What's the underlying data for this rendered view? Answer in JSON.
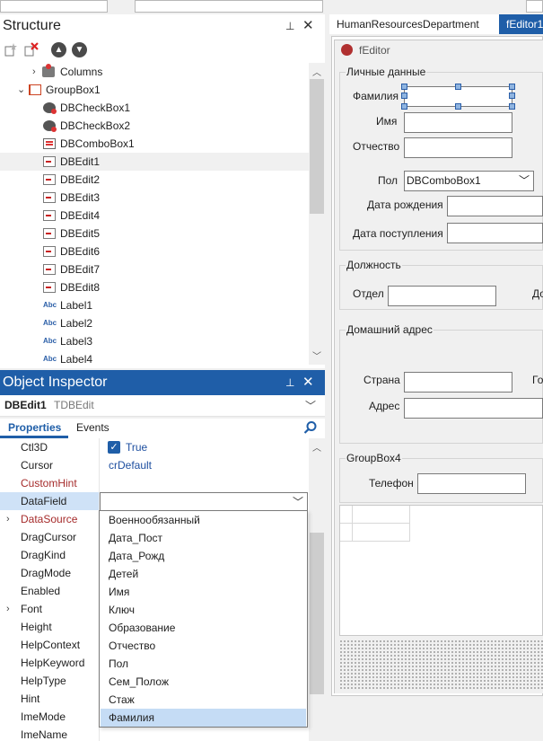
{
  "structure": {
    "title": "Structure",
    "tree": [
      {
        "label": "Columns",
        "icon": "columns-icon",
        "expanded": false
      },
      {
        "label": "GroupBox1",
        "icon": "groupbox-icon",
        "expanded": true
      },
      {
        "label": "DBCheckBox1",
        "icon": "checkbox-icon"
      },
      {
        "label": "DBCheckBox2",
        "icon": "checkbox-icon"
      },
      {
        "label": "DBComboBox1",
        "icon": "combobox-icon"
      },
      {
        "label": "DBEdit1",
        "icon": "edit-icon",
        "selected": true
      },
      {
        "label": "DBEdit2",
        "icon": "edit-icon"
      },
      {
        "label": "DBEdit3",
        "icon": "edit-icon"
      },
      {
        "label": "DBEdit4",
        "icon": "edit-icon"
      },
      {
        "label": "DBEdit5",
        "icon": "edit-icon"
      },
      {
        "label": "DBEdit6",
        "icon": "edit-icon"
      },
      {
        "label": "DBEdit7",
        "icon": "edit-icon"
      },
      {
        "label": "DBEdit8",
        "icon": "edit-icon"
      },
      {
        "label": "Label1",
        "icon": "label-icon"
      },
      {
        "label": "Label2",
        "icon": "label-icon"
      },
      {
        "label": "Label3",
        "icon": "label-icon"
      },
      {
        "label": "Label4",
        "icon": "label-icon"
      }
    ]
  },
  "inspector": {
    "title": "Object Inspector",
    "component_name": "DBEdit1",
    "component_type": "TDBEdit",
    "tabs": {
      "properties": "Properties",
      "events": "Events"
    },
    "properties": [
      {
        "name": "Ctl3D",
        "value": "True",
        "checkbox": true
      },
      {
        "name": "Cursor",
        "value": "crDefault"
      },
      {
        "name": "CustomHint",
        "value": "",
        "color": "#a52a2a"
      },
      {
        "name": "DataField",
        "value": "",
        "selected": true
      },
      {
        "name": "DataSource",
        "value": "",
        "color": "#a52a2a",
        "expandable": true
      },
      {
        "name": "DragCursor",
        "value": ""
      },
      {
        "name": "DragKind",
        "value": ""
      },
      {
        "name": "DragMode",
        "value": ""
      },
      {
        "name": "Enabled",
        "value": ""
      },
      {
        "name": "Font",
        "value": "",
        "expandable": true
      },
      {
        "name": "Height",
        "value": ""
      },
      {
        "name": "HelpContext",
        "value": ""
      },
      {
        "name": "HelpKeyword",
        "value": ""
      },
      {
        "name": "HelpType",
        "value": ""
      },
      {
        "name": "Hint",
        "value": ""
      },
      {
        "name": "ImeMode",
        "value": ""
      },
      {
        "name": "ImeName",
        "value": ""
      }
    ],
    "dropdown_items": [
      "Военнообязанный",
      "Дата_Пост",
      "Дата_Рожд",
      "Детей",
      "Имя",
      "Ключ",
      "Образование",
      "Отчество",
      "Пол",
      "Сем_Полож",
      "Стаж",
      "Фамилия"
    ],
    "dropdown_selected": "Фамилия"
  },
  "editor": {
    "tab_inactive": "HumanResourcesDepartment",
    "tab_active": "fEditor1",
    "form_caption": "fEditor",
    "group_personal": "Личные данные",
    "lbl_surname": "Фамилия",
    "lbl_name": "Имя",
    "lbl_patronymic": "Отчество",
    "lbl_sex": "Пол",
    "combo_sex": "DBComboBox1",
    "lbl_birth": "Дата рождения",
    "lbl_hire": "Дата поступления",
    "group_position": "Должность",
    "lbl_dept": "Отдел",
    "lbl_dept_right": "Дол",
    "group_address": "Домашний адрес",
    "lbl_country": "Страна",
    "lbl_city_right": "Го",
    "lbl_address": "Адрес",
    "group4": "GroupBox4",
    "lbl_phone": "Телефон"
  },
  "colors": {
    "accent": "#1f5ea8",
    "property_value": "#1e4fa0",
    "brown": "#a52a2a"
  }
}
